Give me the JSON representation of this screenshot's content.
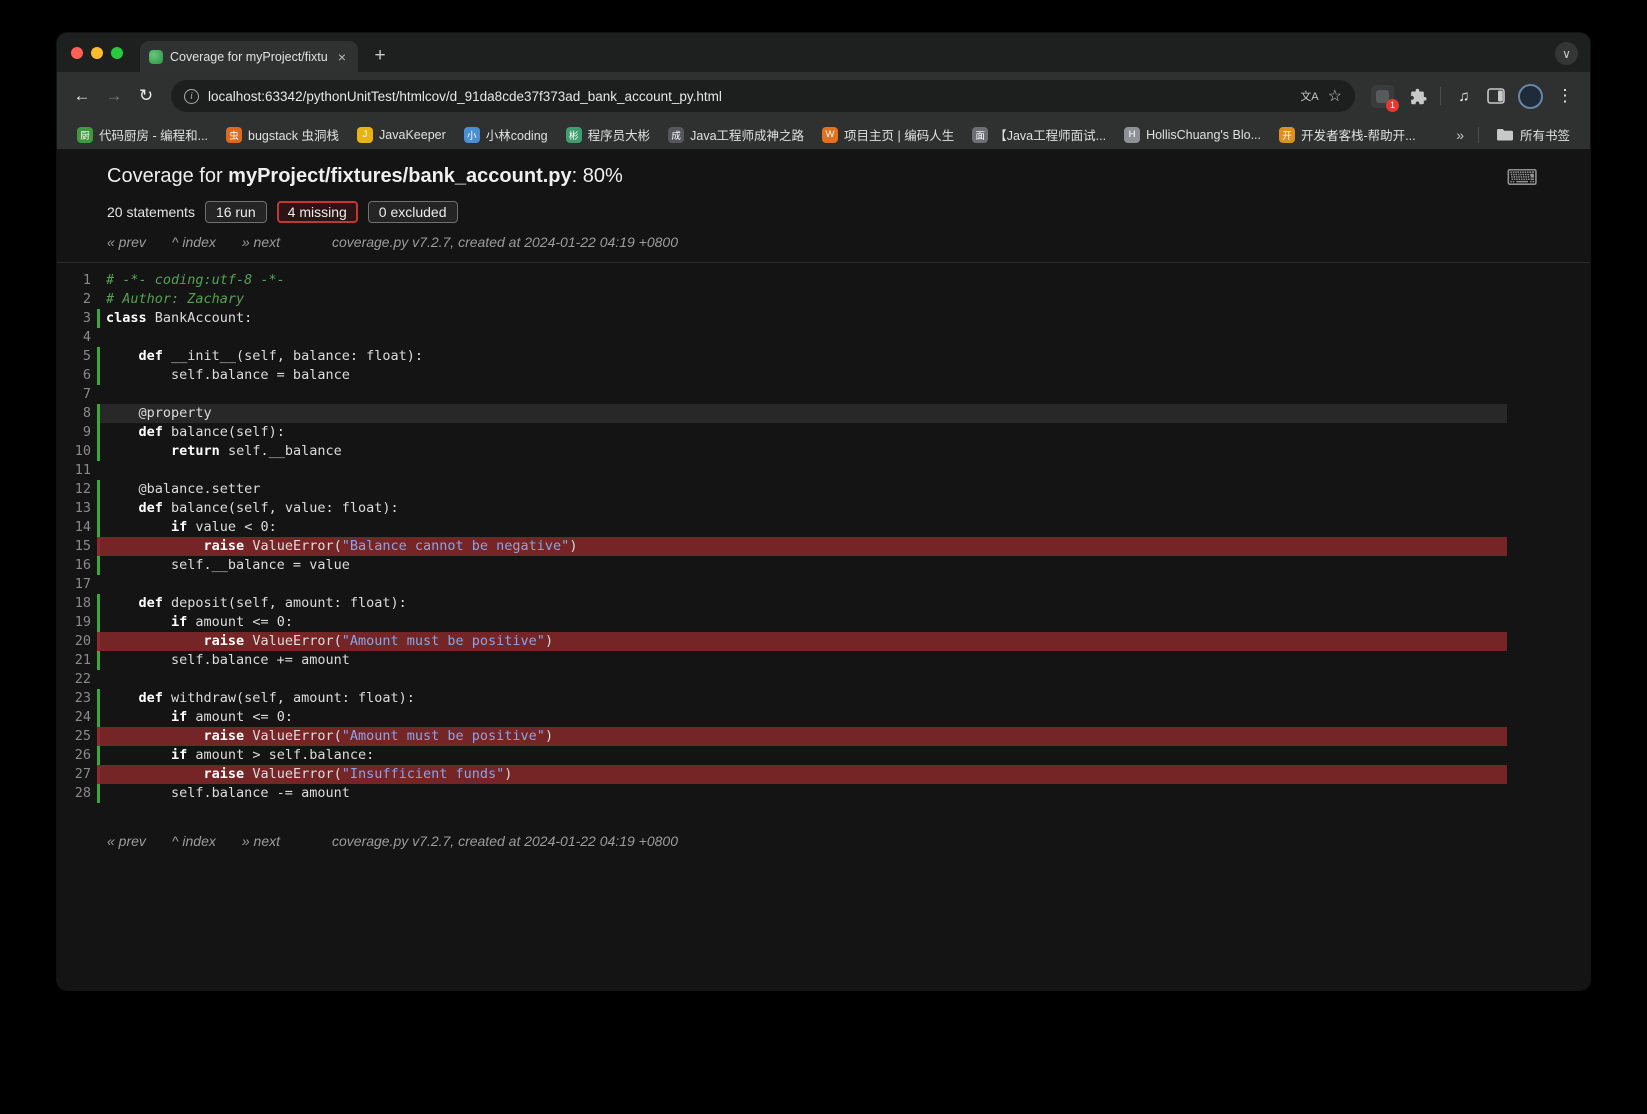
{
  "chrome": {
    "tab": {
      "title": "Coverage for myProject/fixtur",
      "close": "×"
    },
    "new_tab": "+",
    "url": "localhost:63342/pythonUnitTest/htmlcov/d_91da8cde37f373ad_bank_account_py.html",
    "ext_badge": "1",
    "icons": {
      "back": "←",
      "forward": "→",
      "reload": "↻",
      "menu": "⋮",
      "star": "☆",
      "translate": "文A",
      "keyboard": "⌨",
      "media": "♫",
      "chevron_down": "∨",
      "info": "i"
    },
    "bookmarks": [
      {
        "label": "代码厨房 - 编程和...",
        "glyph": "厨",
        "color": "#3d9a3d"
      },
      {
        "label": "bugstack 虫洞栈",
        "glyph": "虫",
        "color": "#e06a1a"
      },
      {
        "label": "JavaKeeper",
        "glyph": "J",
        "color": "#e8b414"
      },
      {
        "label": "小林coding",
        "glyph": "小",
        "color": "#4a8fd4"
      },
      {
        "label": "程序员大彬",
        "glyph": "彬",
        "color": "#3f9d6e"
      },
      {
        "label": "Java工程师成神之路",
        "glyph": "成",
        "color": "#54585c"
      },
      {
        "label": "项目主页 | 编码人生",
        "glyph": "W",
        "color": "#e2701c"
      },
      {
        "label": "【Java工程师面试...",
        "glyph": "面",
        "color": "#6b6f74"
      },
      {
        "label": "HollisChuang's Blo...",
        "glyph": "H",
        "color": "#8d9196"
      },
      {
        "label": "开发者客栈-帮助开...",
        "glyph": "开",
        "color": "#d9921f"
      }
    ],
    "bookmarks_overflow": "»",
    "all_bookmarks": "所有书签"
  },
  "page": {
    "title": {
      "prefix": "Coverage for ",
      "path": "myProject/fixtures/bank_account.py",
      "suffix": ": 80%"
    },
    "stats": {
      "statements": "20 statements",
      "run": "16 run",
      "missing": "4 missing",
      "excluded": "0 excluded"
    },
    "nav": {
      "prev": "« prev",
      "index": "^ index",
      "next": "» next",
      "version": "coverage.py v7.2.7, created at 2024-01-22 04:19 +0800"
    },
    "colors": {
      "missing_bg": "#752525",
      "run_border": "#3aa83a",
      "missing_border": "#c23636"
    },
    "code": [
      {
        "n": 1,
        "st": "nil",
        "tk": [
          [
            "c",
            "# -*- coding:utf-8 -*-"
          ]
        ]
      },
      {
        "n": 2,
        "st": "nil",
        "tk": [
          [
            "c",
            "# Author: Zachary"
          ]
        ]
      },
      {
        "n": 3,
        "st": "run",
        "tk": [
          [
            "k",
            "class"
          ],
          [
            "t",
            " BankAccount:"
          ]
        ]
      },
      {
        "n": 4,
        "st": "nil",
        "tk": []
      },
      {
        "n": 5,
        "st": "run",
        "tk": [
          [
            "t",
            "    "
          ],
          [
            "k",
            "def"
          ],
          [
            "t",
            " __init__(self, balance: float):"
          ]
        ]
      },
      {
        "n": 6,
        "st": "run",
        "tk": [
          [
            "t",
            "        self.balance = balance"
          ]
        ]
      },
      {
        "n": 7,
        "st": "nil",
        "tk": []
      },
      {
        "n": 8,
        "st": "run",
        "hl": true,
        "tk": [
          [
            "t",
            "    @property"
          ]
        ]
      },
      {
        "n": 9,
        "st": "run",
        "tk": [
          [
            "t",
            "    "
          ],
          [
            "k",
            "def"
          ],
          [
            "t",
            " balance(self):"
          ]
        ]
      },
      {
        "n": 10,
        "st": "run",
        "tk": [
          [
            "t",
            "        "
          ],
          [
            "k",
            "return"
          ],
          [
            "t",
            " self.__balance"
          ]
        ]
      },
      {
        "n": 11,
        "st": "nil",
        "tk": []
      },
      {
        "n": 12,
        "st": "run",
        "tk": [
          [
            "t",
            "    @balance.setter"
          ]
        ]
      },
      {
        "n": 13,
        "st": "run",
        "tk": [
          [
            "t",
            "    "
          ],
          [
            "k",
            "def"
          ],
          [
            "t",
            " balance(self, value: float):"
          ]
        ]
      },
      {
        "n": 14,
        "st": "run",
        "tk": [
          [
            "t",
            "        "
          ],
          [
            "k",
            "if"
          ],
          [
            "t",
            " value < 0:"
          ]
        ]
      },
      {
        "n": 15,
        "st": "mis",
        "tk": [
          [
            "t",
            "            "
          ],
          [
            "k",
            "raise"
          ],
          [
            "t",
            " ValueError("
          ],
          [
            "s",
            "\"Balance cannot be negative\""
          ],
          [
            "t",
            ")"
          ]
        ]
      },
      {
        "n": 16,
        "st": "run",
        "tk": [
          [
            "t",
            "        self.__balance = value"
          ]
        ]
      },
      {
        "n": 17,
        "st": "nil",
        "tk": []
      },
      {
        "n": 18,
        "st": "run",
        "tk": [
          [
            "t",
            "    "
          ],
          [
            "k",
            "def"
          ],
          [
            "t",
            " deposit(self, amount: float):"
          ]
        ]
      },
      {
        "n": 19,
        "st": "run",
        "tk": [
          [
            "t",
            "        "
          ],
          [
            "k",
            "if"
          ],
          [
            "t",
            " amount <= 0:"
          ]
        ]
      },
      {
        "n": 20,
        "st": "mis",
        "tk": [
          [
            "t",
            "            "
          ],
          [
            "k",
            "raise"
          ],
          [
            "t",
            " ValueError("
          ],
          [
            "s",
            "\"Amount must be positive\""
          ],
          [
            "t",
            ")"
          ]
        ]
      },
      {
        "n": 21,
        "st": "run",
        "tk": [
          [
            "t",
            "        self.balance += amount"
          ]
        ]
      },
      {
        "n": 22,
        "st": "nil",
        "tk": []
      },
      {
        "n": 23,
        "st": "run",
        "tk": [
          [
            "t",
            "    "
          ],
          [
            "k",
            "def"
          ],
          [
            "t",
            " withdraw(self, amount: float):"
          ]
        ]
      },
      {
        "n": 24,
        "st": "run",
        "tk": [
          [
            "t",
            "        "
          ],
          [
            "k",
            "if"
          ],
          [
            "t",
            " amount <= 0:"
          ]
        ]
      },
      {
        "n": 25,
        "st": "mis",
        "tk": [
          [
            "t",
            "            "
          ],
          [
            "k",
            "raise"
          ],
          [
            "t",
            " ValueError("
          ],
          [
            "s",
            "\"Amount must be positive\""
          ],
          [
            "t",
            ")"
          ]
        ]
      },
      {
        "n": 26,
        "st": "run",
        "tk": [
          [
            "t",
            "        "
          ],
          [
            "k",
            "if"
          ],
          [
            "t",
            " amount > self.balance:"
          ]
        ]
      },
      {
        "n": 27,
        "st": "mis",
        "tk": [
          [
            "t",
            "            "
          ],
          [
            "k",
            "raise"
          ],
          [
            "t",
            " ValueError("
          ],
          [
            "s",
            "\"Insufficient funds\""
          ],
          [
            "t",
            ")"
          ]
        ]
      },
      {
        "n": 28,
        "st": "run",
        "tk": [
          [
            "t",
            "        self.balance -= amount"
          ]
        ]
      }
    ]
  }
}
